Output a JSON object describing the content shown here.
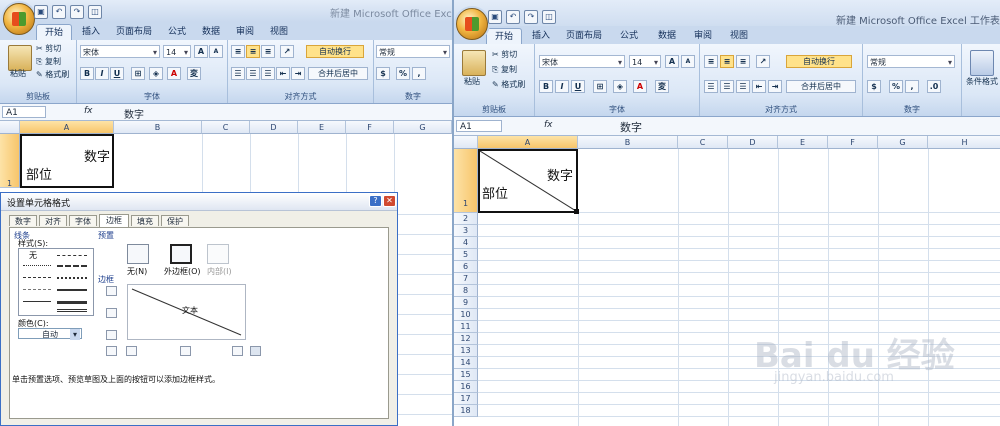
{
  "colors": {
    "accent": "#ffe28a",
    "ribbon": "#dbe7f6",
    "tab_active": "#eef4fc",
    "selection": "#f7c56b"
  },
  "left": {
    "title": "新建 Microsoft Office Excel",
    "tabs": [
      "开始",
      "插入",
      "页面布局",
      "公式",
      "数据",
      "审阅",
      "视图"
    ],
    "clipboard": {
      "paste": "粘贴",
      "cut": "剪切",
      "copy": "复制",
      "format_painter": "格式刷",
      "label": "剪贴板"
    },
    "font": {
      "name": "宋体",
      "size": "14",
      "bold": "B",
      "italic": "I",
      "underline": "U",
      "label": "字体",
      "grow": "A",
      "shrink": "A"
    },
    "alignment": {
      "wrap": "自动换行",
      "merge": "合并后居中",
      "label": "对齐方式"
    },
    "number": {
      "format": "常规",
      "label": "数字",
      "percent": "%",
      "comma": ","
    },
    "namebox": "A1",
    "fx": "fx",
    "formula": "数字",
    "columns": [
      "A",
      "B",
      "C",
      "D",
      "E",
      "F",
      "G"
    ],
    "cell_a1": {
      "top": "数字",
      "bottom": "部位"
    },
    "row1": "1"
  },
  "dialog": {
    "title": "设置单元格格式",
    "tabs": [
      "数字",
      "对齐",
      "字体",
      "边框",
      "填充",
      "保护"
    ],
    "active_tab": "边框",
    "line_section": "线条",
    "style_label": "样式(S):",
    "none_style": "无",
    "color_label": "颜色(C):",
    "color_value": "自动",
    "presets_section": "预置",
    "preset_none": "无(N)",
    "preset_outline": "外边框(O)",
    "preset_inside": "内部(I)",
    "border_section": "边框",
    "preview_text": "文本",
    "hint": "单击预置选项、预览草图及上面的按钮可以添加边框样式。"
  },
  "right": {
    "title": "新建 Microsoft Office Excel 工作表 (2",
    "tabs": [
      "开始",
      "插入",
      "页面布局",
      "公式",
      "数据",
      "审阅",
      "视图"
    ],
    "clipboard": {
      "paste": "粘贴",
      "cut": "剪切",
      "copy": "复制",
      "format_painter": "格式刷",
      "label": "剪贴板"
    },
    "font": {
      "name": "宋体",
      "size": "14",
      "bold": "B",
      "italic": "I",
      "underline": "U",
      "label": "字体",
      "grow": "A",
      "shrink": "A"
    },
    "alignment": {
      "wrap": "自动换行",
      "merge": "合并后居中",
      "label": "对齐方式"
    },
    "number": {
      "format": "常规",
      "label": "数字",
      "percent": "%",
      "comma": ","
    },
    "styles": {
      "conditional": "条件格式"
    },
    "namebox": "A1",
    "fx": "fx",
    "formula": "数字",
    "columns": [
      "A",
      "B",
      "C",
      "D",
      "E",
      "F",
      "G",
      "H"
    ],
    "rows": [
      "1",
      "2",
      "3",
      "4",
      "5",
      "6",
      "7",
      "8",
      "9",
      "10",
      "11",
      "12",
      "13",
      "14",
      "15",
      "16",
      "17",
      "18"
    ],
    "cell_a1": {
      "top": "数字",
      "bottom": "部位"
    }
  },
  "watermark": {
    "logo": "Bai du 经验",
    "url": "jingyan.baidu.com"
  }
}
